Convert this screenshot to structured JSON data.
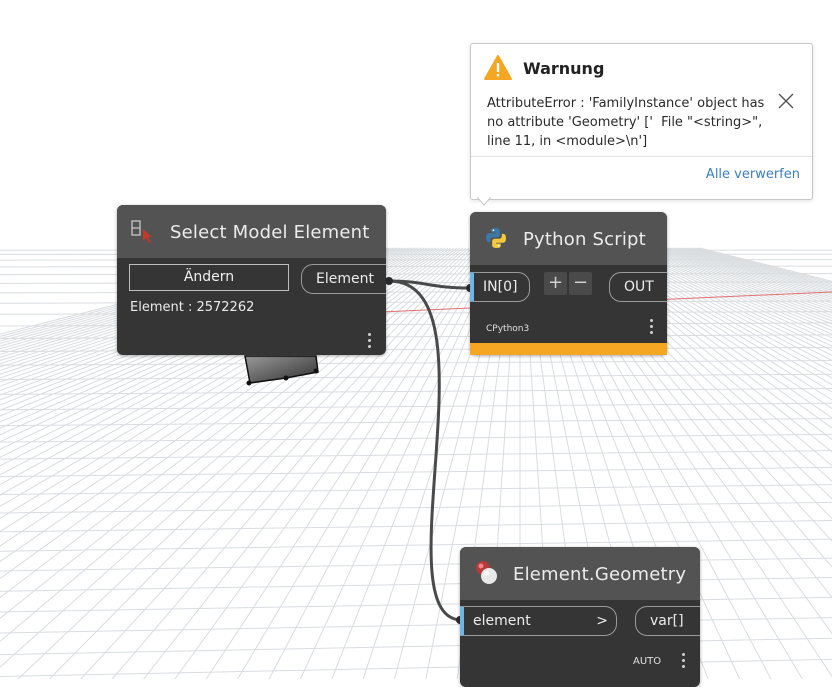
{
  "warning": {
    "title": "Warnung",
    "message": "AttributeError : 'FamilyInstance' object has no attribute 'Geometry' ['  File \"<string>\", line 11, in <module>\\n']",
    "dismiss_all_label": "Alle verwerfen",
    "icon": "warning-triangle-icon",
    "accent_color": "#f5a623"
  },
  "select_node": {
    "title": "Select Model Element",
    "change_button_label": "Ändern",
    "output_port_label": "Element",
    "element_text": "Element : 2572262",
    "icon": "select-element-icon"
  },
  "python_node": {
    "title": "Python Script",
    "input_port_label": "IN[0]",
    "add_input_label": "+",
    "remove_input_label": "−",
    "output_port_label": "OUT",
    "engine_label": "CPython3",
    "warning_bar_color": "#f5a623",
    "icon": "python-logo-icon"
  },
  "geometry_node": {
    "title": "Element.Geometry",
    "input_port_label": "element",
    "input_arrow_label": ">",
    "output_port_label": "var[]",
    "lacing_label": "AUTO",
    "icon": "geometry-sphere-icon"
  },
  "colors": {
    "node_body": "#353535",
    "node_header": "#535353",
    "input_port_accent": "#6eb6e6",
    "wire": "#4a4a4a",
    "grid_line": "#d9dde0",
    "axis_x": "#e07070"
  }
}
